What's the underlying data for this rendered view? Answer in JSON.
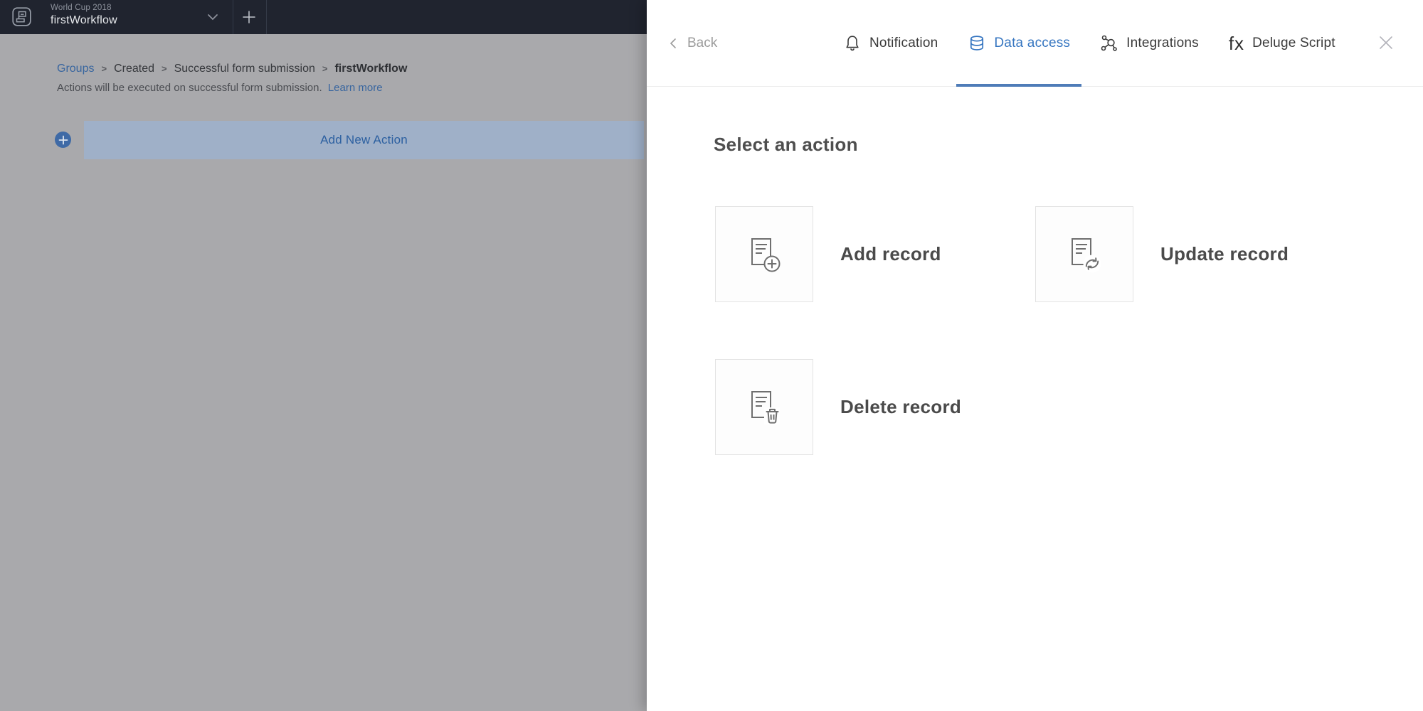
{
  "left_page": {
    "topbar": {
      "app_title": "World Cup 2018",
      "workflow_name": "firstWorkflow",
      "plus_symbol": "+"
    },
    "breadcrumb": {
      "items": [
        "Groups",
        "Created",
        "Successful form submission",
        "firstWorkflow"
      ],
      "separator": ">"
    },
    "description": "Actions will be executed on successful form submission.",
    "learn_more": "Learn more",
    "add_new_action": "Add New Action"
  },
  "panel": {
    "back_label": "Back",
    "tabs": [
      {
        "label": "Notification",
        "icon": "bell-icon",
        "active": false
      },
      {
        "label": "Data access",
        "icon": "database-icon",
        "active": true
      },
      {
        "label": "Integrations",
        "icon": "nodes-icon",
        "active": false
      },
      {
        "label": "Deluge Script",
        "icon": "fx-icon",
        "icon_text": "fx",
        "active": false
      }
    ],
    "heading": "Select an action",
    "actions": [
      {
        "label": "Add record",
        "icon": "document-plus-icon"
      },
      {
        "label": "Update record",
        "icon": "document-refresh-icon"
      },
      {
        "label": "Delete record",
        "icon": "document-trash-icon"
      }
    ]
  },
  "colors": {
    "topbar_bg": "#20242f",
    "dimmed_overlay": "#a9a9ac",
    "accent_blue": "#3575c0",
    "tab_underline": "#4f7cb8",
    "dimmed_link_blue": "#39669f",
    "add_action_bar_bg": "#9fb0c8",
    "add_action_text": "#2b5fa0",
    "card_border": "#e3e3e3",
    "icon_gray": "#6f6f6f",
    "label_gray": "#4a4a4a"
  }
}
